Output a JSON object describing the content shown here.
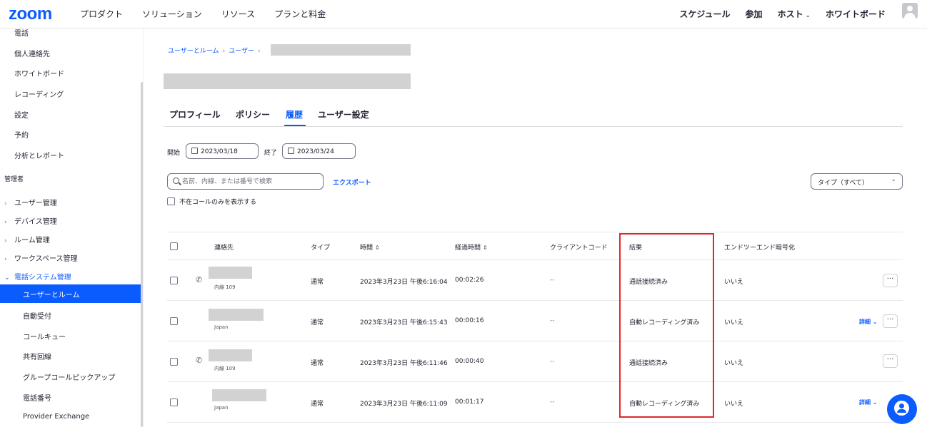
{
  "header": {
    "logo": "zoom",
    "nav": [
      "プロダクト",
      "ソリューション",
      "リソース",
      "プランと料金"
    ],
    "right": [
      "スケジュール",
      "参加",
      "ホスト",
      "ホワイトボード"
    ]
  },
  "sidebar": {
    "top_items": [
      "電話",
      "個人連絡先",
      "ホワイトボード",
      "レコーディング",
      "設定",
      "予約",
      "分析とレポート"
    ],
    "section": "管理者",
    "groups": [
      "ユーザー管理",
      "デバイス管理",
      "ルーム管理",
      "ワークスペース管理",
      "電話システム管理"
    ],
    "active": "ユーザーとルーム",
    "sub_items": [
      "自動受付",
      "コールキュー",
      "共有回線",
      "グループコールピックアップ",
      "電話番号",
      "Provider Exchange"
    ]
  },
  "breadcrumb": [
    "ユーザーとルーム",
    "ユーザー"
  ],
  "tabs": [
    "プロフィール",
    "ポリシー",
    "履歴",
    "ユーザー設定"
  ],
  "filters": {
    "start_label": "開始",
    "start_date": "2023/03/18",
    "end_label": "終了",
    "end_date": "2023/03/24",
    "search_placeholder": "名前、内線、または番号で検索",
    "export": "エクスポート",
    "type_select": "タイプ（すべて）",
    "missed_only": "不在コールのみを表示する"
  },
  "table": {
    "headers": [
      "連絡先",
      "タイプ",
      "時間",
      "経過時間",
      "クライアントコード",
      "結果",
      "エンドツーエンド暗号化"
    ],
    "rows": [
      {
        "sub": "内線 109",
        "type": "通常",
        "time": "2023年3月23日 午後6:16:04",
        "duration": "00:02:26",
        "code": "--",
        "result": "通話接続済み",
        "e2e": "いいえ",
        "detail": ""
      },
      {
        "sub": "Japan",
        "type": "通常",
        "time": "2023年3月23日 午後6:15:43",
        "duration": "00:00:16",
        "code": "--",
        "result": "自動レコーディング済み",
        "e2e": "いいえ",
        "detail": "詳細"
      },
      {
        "sub": "内線 109",
        "type": "通常",
        "time": "2023年3月23日 午後6:11:46",
        "duration": "00:00:40",
        "code": "--",
        "result": "通話接続済み",
        "e2e": "いいえ",
        "detail": ""
      },
      {
        "sub": "Japan",
        "type": "通常",
        "time": "2023年3月23日 午後6:11:09",
        "duration": "00:01:17",
        "code": "--",
        "result": "自動レコーディング済み",
        "e2e": "いいえ",
        "detail": "詳細"
      }
    ]
  },
  "icons": {
    "more": "more-horizontal-icon",
    "phone": "phone-icon",
    "calendar": "calendar-icon",
    "chat": "chat-icon"
  },
  "colors": {
    "brand": "#0b5cff",
    "highlight": "#e02828"
  }
}
